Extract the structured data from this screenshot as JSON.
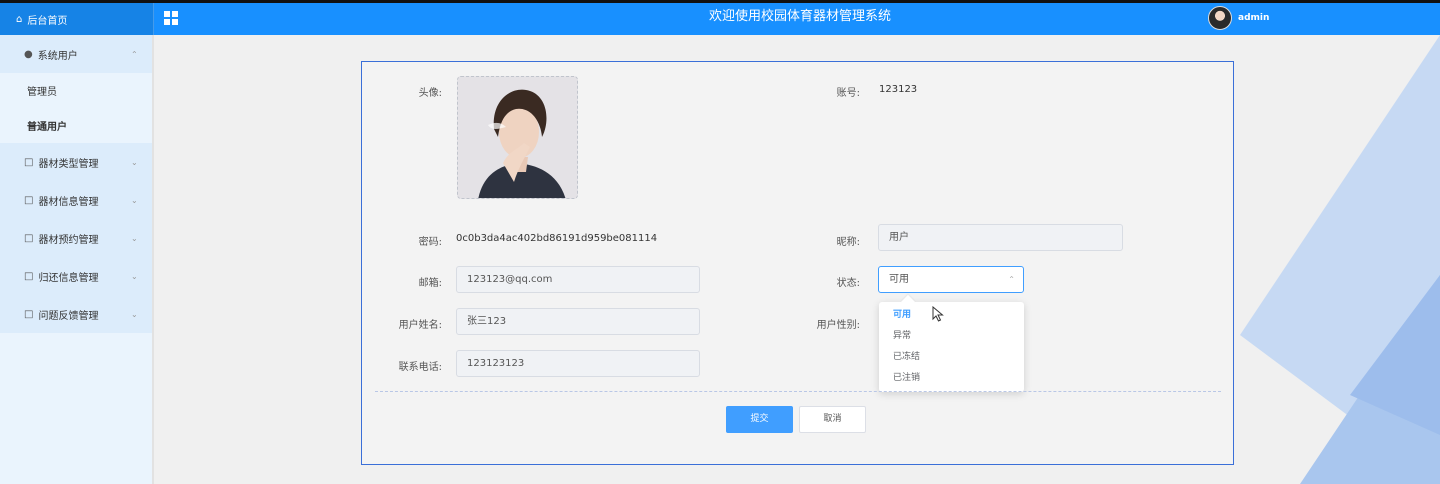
{
  "header": {
    "home_label": "后台首页",
    "title": "欢迎使用校园体育器材管理系统",
    "username": "admin"
  },
  "sidebar": {
    "group": {
      "label": "系统用户",
      "children": [
        "管理员",
        "普通用户"
      ],
      "active": "普通用户"
    },
    "items": [
      {
        "label": "器材类型管理"
      },
      {
        "label": "器材信息管理"
      },
      {
        "label": "器材预约管理"
      },
      {
        "label": "归还信息管理"
      },
      {
        "label": "问题反馈管理"
      }
    ]
  },
  "form": {
    "avatar_label": "头像:",
    "account_label": "账号:",
    "account_value": "123123",
    "password_label": "密码:",
    "password_value": "0c0b3da4ac402bd86191d959be081114",
    "nickname_label": "昵称:",
    "nickname_value": "用户",
    "email_label": "邮箱:",
    "email_value": "123123@qq.com",
    "status_label": "状态:",
    "status_value": "可用",
    "realname_label": "用户姓名:",
    "realname_value": "张三123",
    "gender_label": "用户性别:",
    "phone_label": "联系电话:",
    "phone_value": "123123123",
    "status_options": [
      "可用",
      "异常",
      "已冻结",
      "已注销"
    ],
    "status_selected": "可用",
    "submit_label": "提交",
    "cancel_label": "取消"
  },
  "colors": {
    "header_bg": "#1890ff",
    "primary": "#409eff",
    "sidebar_bg": "#eaf4fd"
  }
}
